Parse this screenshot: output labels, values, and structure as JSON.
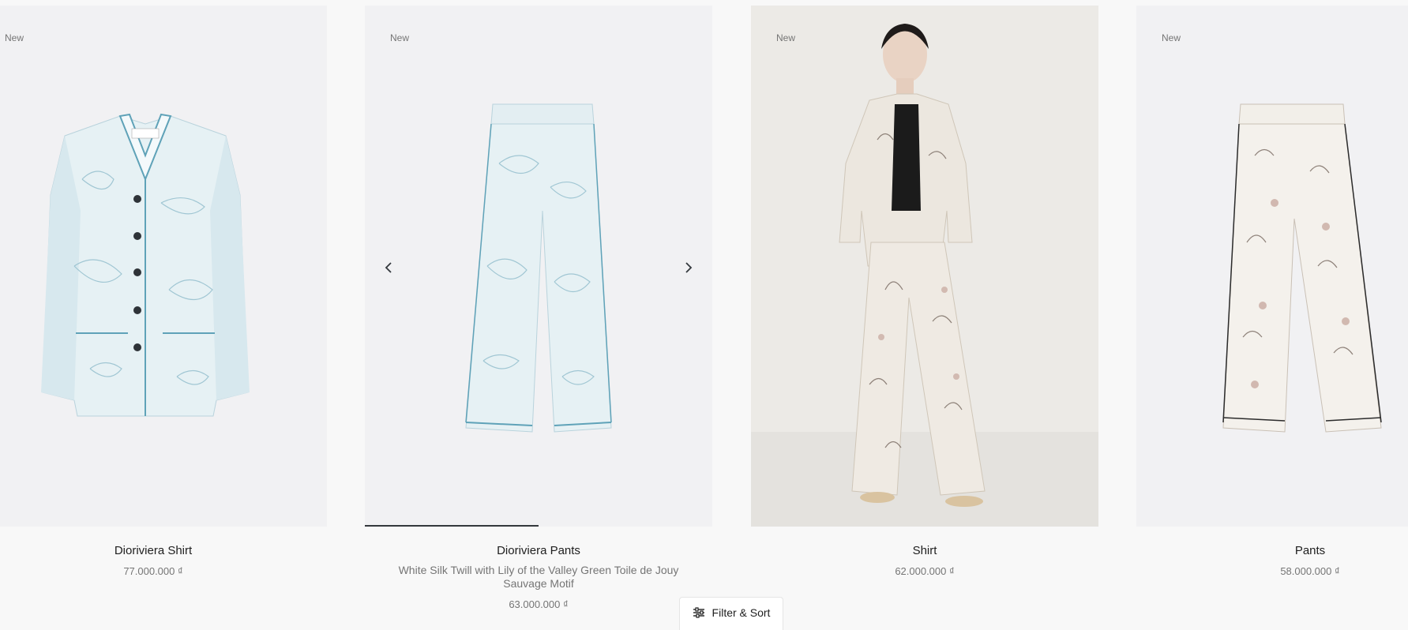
{
  "products": [
    {
      "badge": "New",
      "name": "Dioriviera Shirt",
      "description": "",
      "price": "77.000.000 ₫",
      "image_icon": "toile-shirt-image",
      "accent": "#5fa2b8"
    },
    {
      "badge": "New",
      "name": "Dioriviera Pants",
      "description": "White Silk Twill with Lily of the Valley Green Toile de Jouy Sauvage Motif",
      "price": "63.000.000 ₫",
      "image_icon": "toile-pants-image",
      "accent": "#5fa2b8",
      "carousel": {
        "prev_icon": "chevron-left-icon",
        "next_icon": "chevron-right-icon",
        "progress": 0.5
      }
    },
    {
      "badge": "New",
      "name": "Shirt",
      "description": "",
      "price": "62.000.000 ₫",
      "image_icon": "model-floral-pajama-image",
      "accent": "#8a7b70"
    },
    {
      "badge": "New",
      "name": "Pants",
      "description": "",
      "price": "58.000.000 ₫",
      "image_icon": "floral-pants-image",
      "accent": "#8a7b70"
    }
  ],
  "filter_button": {
    "label": "Filter & Sort",
    "icon": "sliders-icon"
  }
}
